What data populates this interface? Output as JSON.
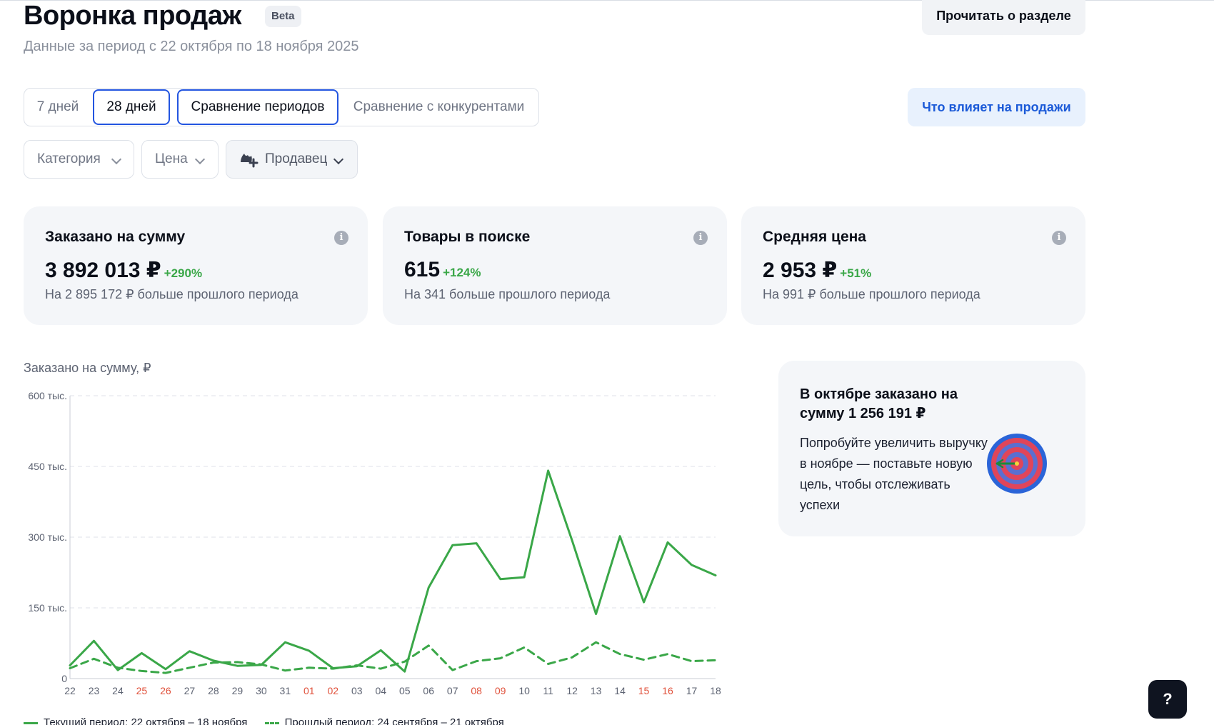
{
  "header": {
    "title": "Воронка продаж",
    "beta_badge": "Beta",
    "subtitle": "Данные за период с 22 октября по 18 ноября 2025",
    "read_button": "Прочитать о разделе"
  },
  "period_tabs": [
    {
      "label": "7 дней",
      "active": false
    },
    {
      "label": "28 дней",
      "active": true
    },
    {
      "label": "Сравнение периодов",
      "active": true
    },
    {
      "label": "Сравнение с конкурентами",
      "active": false
    }
  ],
  "factors_button": "Что влияет на продажи",
  "filters": [
    {
      "label": "Категория",
      "icon": "chevron-down-icon"
    },
    {
      "label": "Цена",
      "icon": "chevron-down-icon"
    },
    {
      "label": "Продавец",
      "icon": "seller-icon"
    }
  ],
  "kpi_cards": [
    {
      "title": "Заказано на сумму",
      "value": "3 892 013 ₽",
      "delta": "+290%",
      "note": "На 2 895 172 ₽ больше прошлого периода"
    },
    {
      "title": "Товары в поиске",
      "value": "615",
      "delta": "+124%",
      "note": "На 341 больше прошлого периода"
    },
    {
      "title": "Средняя цена",
      "value": "2 953 ₽",
      "delta": "+51%",
      "note": "На 991 ₽ больше прошлого периода"
    }
  ],
  "chart_title": "Заказано на сумму, ₽",
  "chart_data": {
    "type": "line",
    "title": "Заказано на сумму, ₽",
    "xlabel": "",
    "ylabel": "",
    "ylim": [
      0,
      600000
    ],
    "y_ticks": [
      0,
      150000,
      300000,
      450000,
      600000
    ],
    "y_tick_labels": [
      "0",
      "150 тыс.",
      "300 тыс.",
      "450 тыс.",
      "600 тыс."
    ],
    "categories": [
      "22",
      "23",
      "24",
      "25",
      "26",
      "27",
      "28",
      "29",
      "30",
      "31",
      "01",
      "02",
      "03",
      "04",
      "05",
      "06",
      "07",
      "08",
      "09",
      "10",
      "11",
      "12",
      "13",
      "14",
      "15",
      "16",
      "17",
      "18"
    ],
    "weekend_categories": [
      "25",
      "26",
      "01",
      "02",
      "08",
      "09",
      "15",
      "16"
    ],
    "grid": "horizontal dashed",
    "legend_position": "bottom-left",
    "series": [
      {
        "name": "Текущий период: 22 октября – 18 ноября",
        "style": "solid",
        "color": "#3aa748",
        "values": [
          28000,
          80000,
          18000,
          54000,
          20000,
          58000,
          38000,
          27000,
          29000,
          77000,
          59000,
          22000,
          26000,
          60000,
          15000,
          193000,
          283000,
          287000,
          211000,
          215000,
          441000,
          293000,
          137000,
          302000,
          162000,
          289000,
          241000,
          219000
        ]
      },
      {
        "name": "Прошлый период: 24 сентября – 21 октября",
        "style": "dashed",
        "color": "#3aa748",
        "values": [
          22000,
          42000,
          23000,
          16000,
          12000,
          23000,
          34000,
          35000,
          30000,
          17000,
          23000,
          21000,
          28000,
          21000,
          36000,
          70000,
          18000,
          37000,
          43000,
          66000,
          31000,
          45000,
          77000,
          52000,
          40000,
          52000,
          37000,
          39000
        ]
      }
    ]
  },
  "promo": {
    "title": "В октябре заказано на сумму 1 256 191 ₽",
    "text": "Попробуйте увеличить выручку в ноябре — поставьте новую цель, чтобы отслеживать успехи",
    "icon": "target-icon"
  },
  "help_button": "?",
  "colors": {
    "accent": "#2355e0",
    "positive": "#3aa748",
    "weekend": "#e0513b",
    "card_bg": "#f4f6f9"
  }
}
